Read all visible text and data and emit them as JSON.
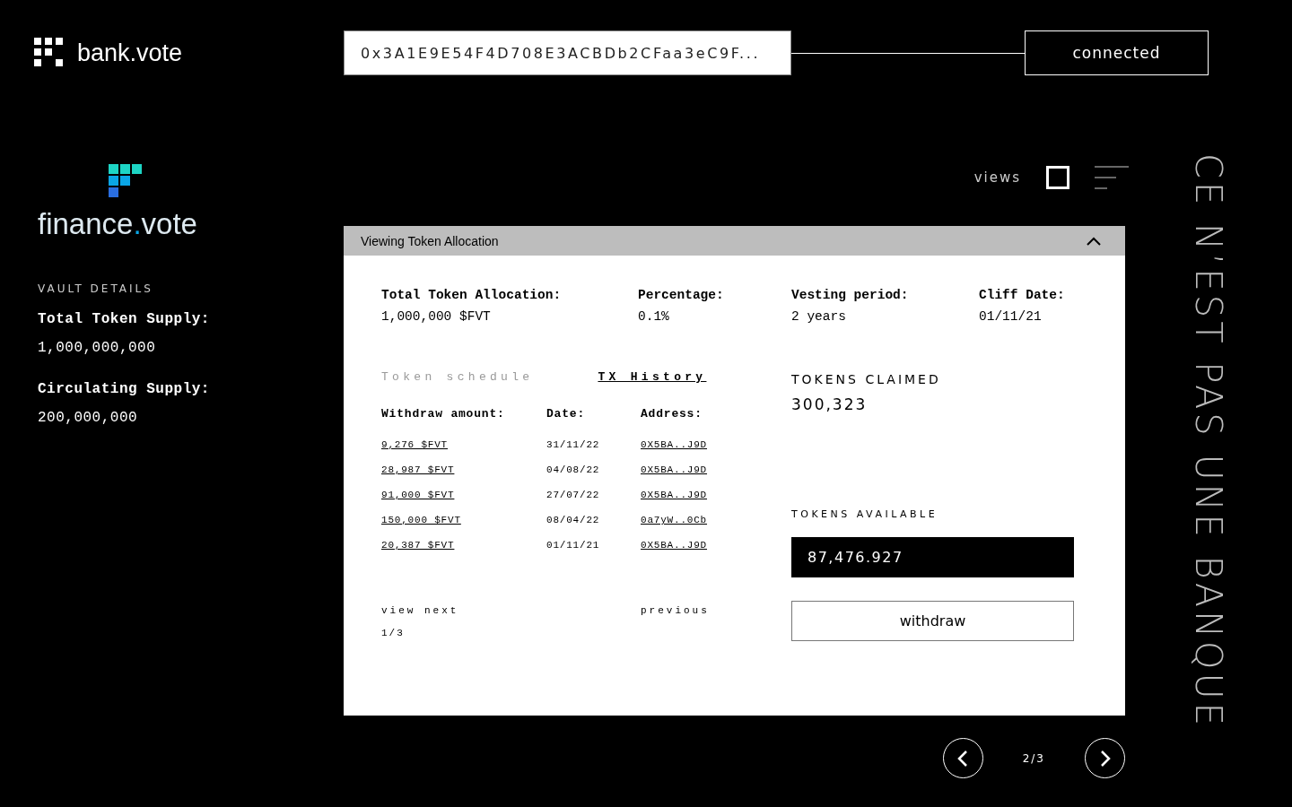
{
  "header": {
    "brand": "bank.vote",
    "address": "0x3A1E9E54F4D708E3ACBDb2CFaa3eC9F...",
    "status": "connected"
  },
  "sidebar": {
    "logo": {
      "prefix": "finance",
      "dot": ".",
      "suffix": "vote"
    },
    "section_title": "VAULT DETAILS",
    "details": [
      {
        "label": "Total Token Supply:",
        "value": "1,000,000,000"
      },
      {
        "label": "Circulating Supply:",
        "value": "200,000,000"
      }
    ]
  },
  "views": {
    "label": "views",
    "options": [
      {
        "kind": "grid",
        "selected": true
      },
      {
        "kind": "list",
        "selected": false
      }
    ]
  },
  "panel": {
    "title": "Viewing Token Allocation",
    "expanded": true,
    "stats": [
      {
        "label": "Total Token Allocation:",
        "value": "1,000,000 $FVT"
      },
      {
        "label": "Percentage:",
        "value": "0.1%"
      },
      {
        "label": "Vesting period:",
        "value": "2 years"
      },
      {
        "label": "Cliff Date:",
        "value": "01/11/21"
      }
    ],
    "tabs": [
      {
        "label": "Token schedule",
        "selected": false
      },
      {
        "label": "TX History",
        "selected": true
      }
    ],
    "table": {
      "columns": [
        "Withdraw amount:",
        "Date:",
        "Address:"
      ],
      "rows": [
        [
          "9,276 $FVT",
          "31/11/22",
          "0X5BA..J9D"
        ],
        [
          "28,987 $FVT",
          "04/08/22",
          "0X5BA..J9D"
        ],
        [
          "91,000 $FVT",
          "27/07/22",
          "0X5BA..J9D"
        ],
        [
          "150,000 $FVT",
          "08/04/22",
          "0a7yW..0Cb"
        ],
        [
          "20,387 $FVT",
          "01/11/21",
          "0X5BA..J9D"
        ]
      ]
    },
    "pagination": {
      "next": "view next",
      "previous": "previous",
      "page": "1/3"
    },
    "claimed": {
      "label": "TOKENS CLAIMED",
      "value": "300,323"
    },
    "available": {
      "label": "TOKENS AVAILABLE",
      "value": "87,476.927"
    },
    "withdraw_button": "withdraw"
  },
  "pager": {
    "page": "2/3"
  },
  "slogan": "CE N’EST PAS UNE BANQUE"
}
